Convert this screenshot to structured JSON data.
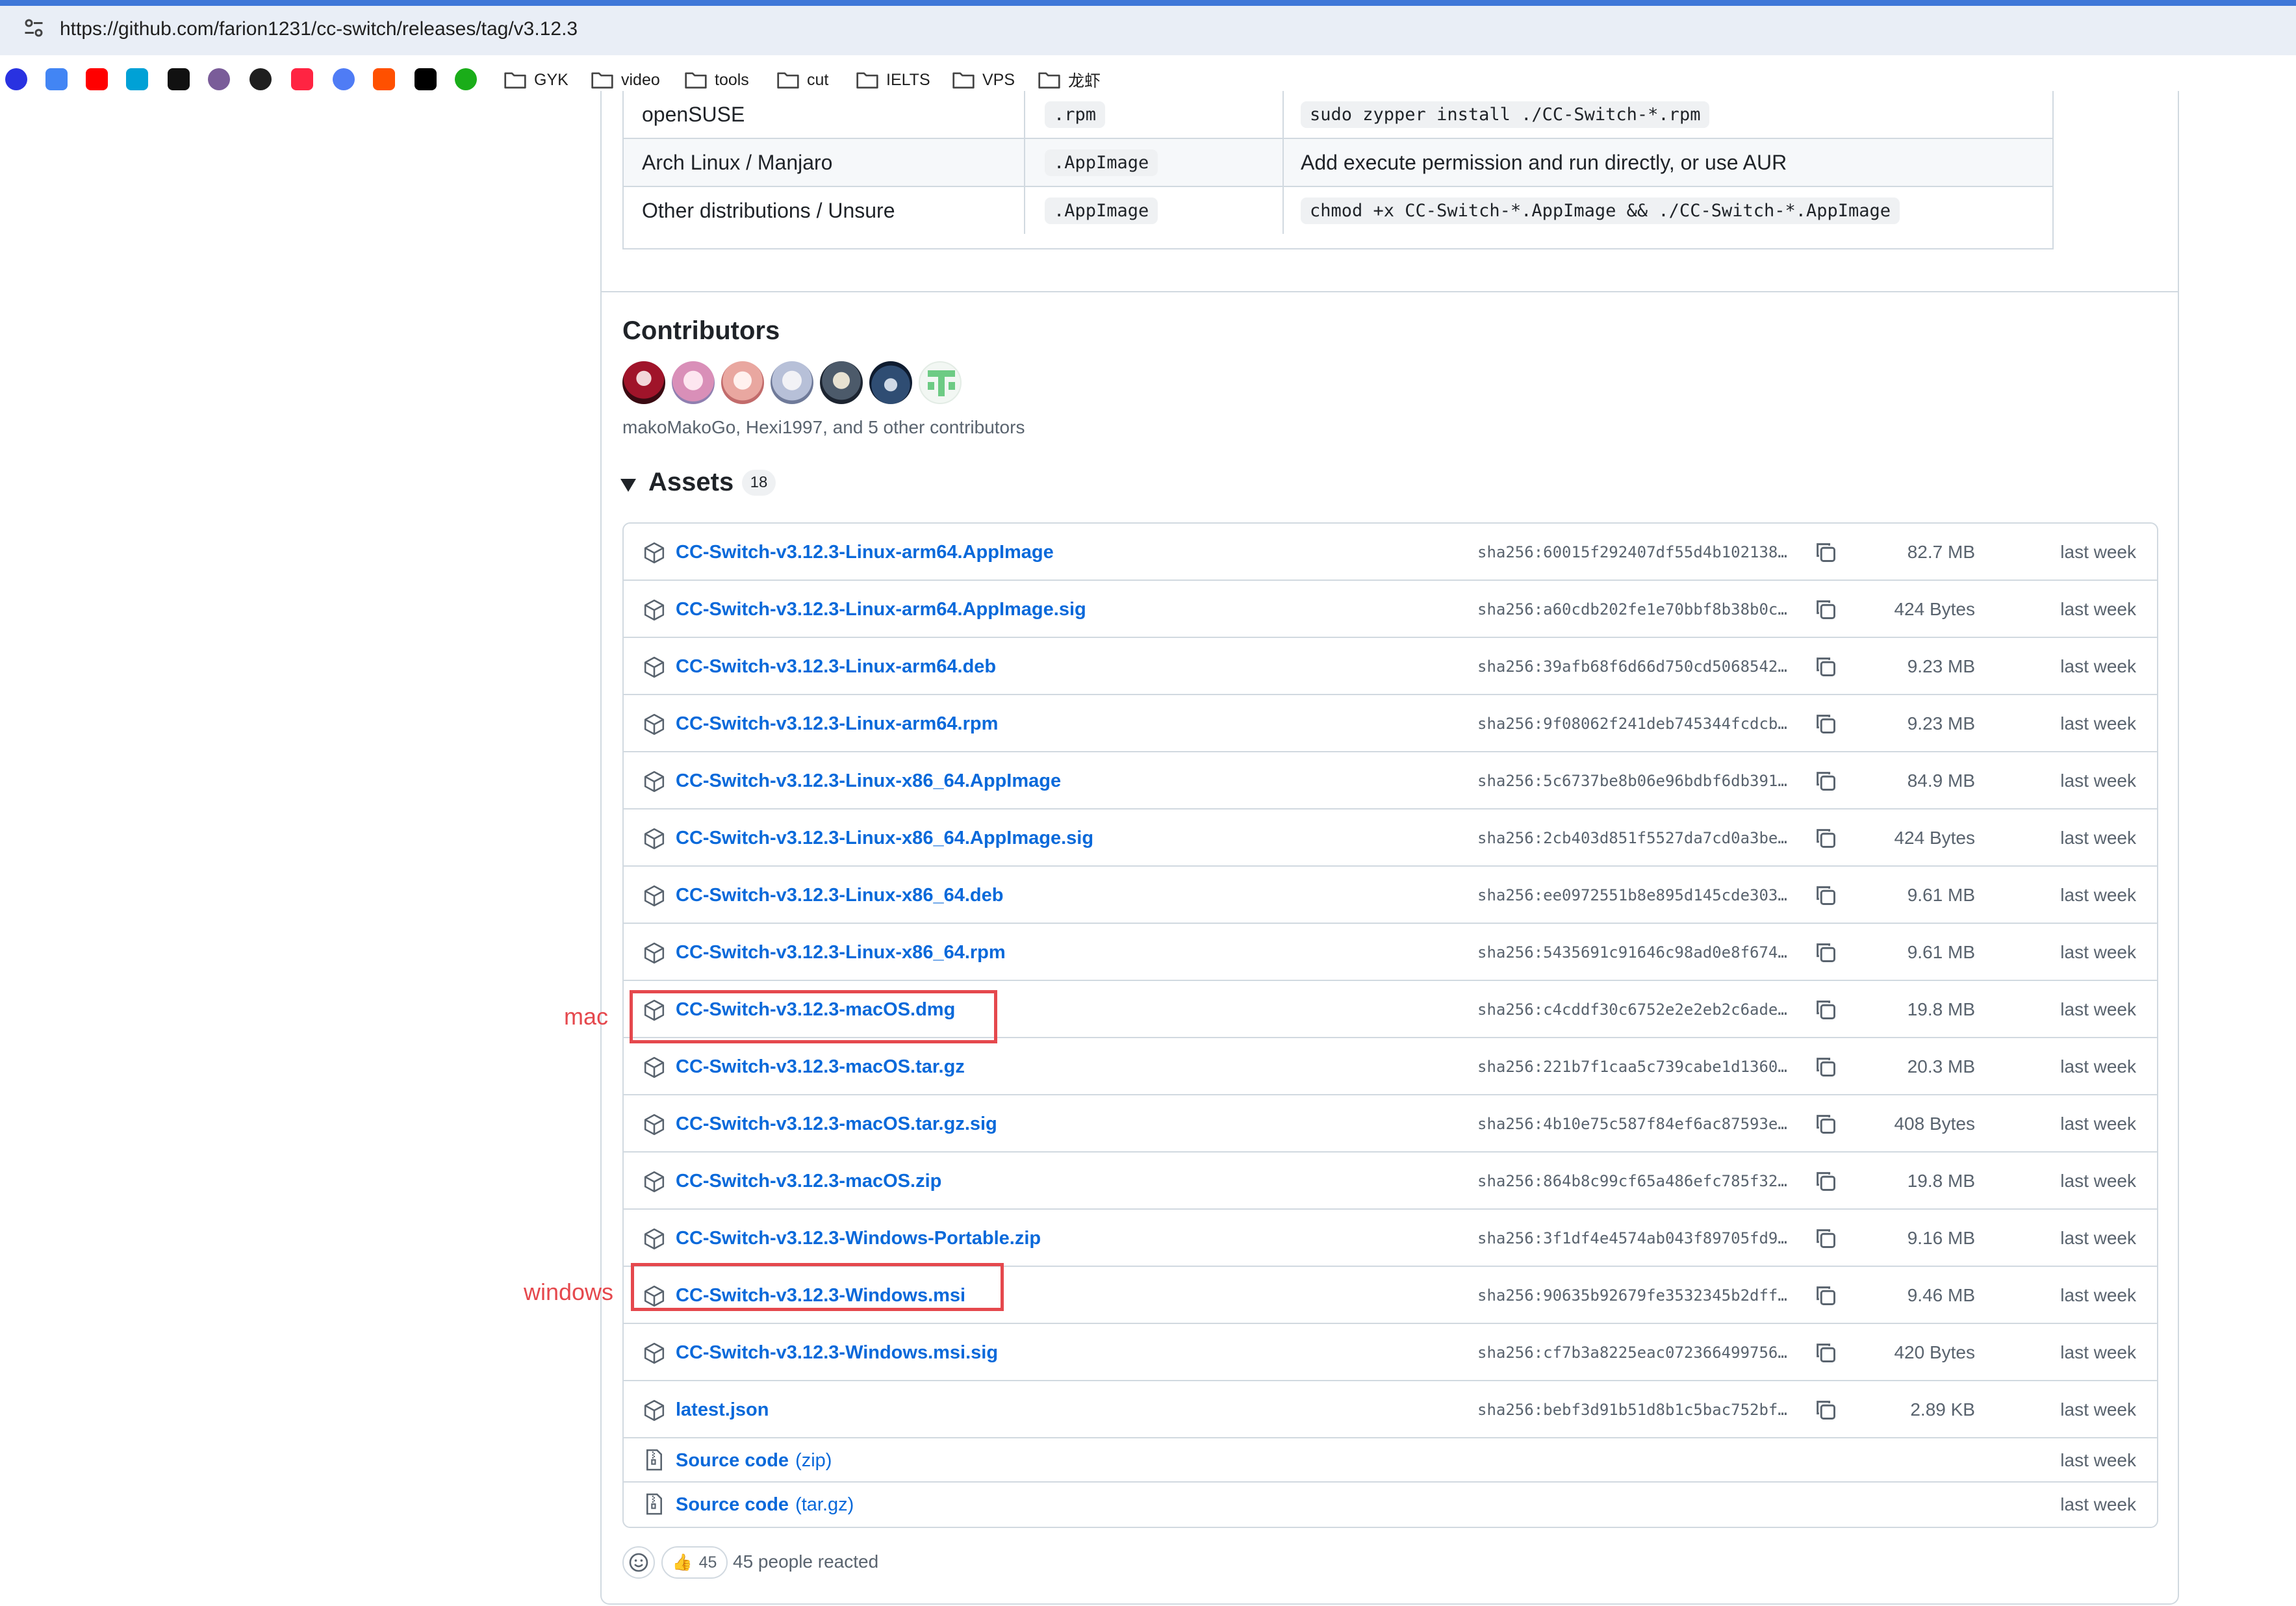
{
  "browser": {
    "url": "https://github.com/farion1231/cc-switch/releases/tag/v3.12.3",
    "bookmark_icons": [
      {
        "name": "baidu",
        "color": "#2932e1"
      },
      {
        "name": "translate",
        "color": "#4285f4"
      },
      {
        "name": "youtube",
        "color": "#ff0000"
      },
      {
        "name": "bilibili",
        "color": "#00a1d6"
      },
      {
        "name": "tiktok",
        "color": "#111111"
      },
      {
        "name": "avatar-site",
        "color": "#7a5c99"
      },
      {
        "name": "openai",
        "color": "#1f1f1f"
      },
      {
        "name": "xiaohongshu",
        "color": "#ff2442"
      },
      {
        "name": "gemini",
        "color": "#4f7cf5"
      },
      {
        "name": "taobao",
        "color": "#ff5000"
      },
      {
        "name": "x",
        "color": "#000000"
      },
      {
        "name": "recycle",
        "color": "#1aad19"
      }
    ],
    "bookmark_folders": [
      "GYK",
      "video",
      "tools",
      "cut",
      "IELTS",
      "VPS",
      "龙虾"
    ]
  },
  "install_table": {
    "rows": [
      {
        "distro": "openSUSE",
        "format": ".rpm",
        "method": "sudo zypper install ./CC-Switch-*.rpm",
        "method_is_code": true
      },
      {
        "distro": "Arch Linux / Manjaro",
        "format": ".AppImage",
        "method": "Add execute permission and run directly, or use AUR",
        "method_is_code": false
      },
      {
        "distro": "Other distributions / Unsure",
        "format": ".AppImage",
        "method": "chmod +x CC-Switch-*.AppImage && ./CC-Switch-*.AppImage",
        "method_is_code": true
      }
    ]
  },
  "contributors": {
    "heading": "Contributors",
    "summary": "makoMakoGo, Hexi1997, and 5 other contributors",
    "avatar_count": 7
  },
  "assets": {
    "heading": "Assets",
    "count": "18",
    "files": [
      {
        "name": "CC-Switch-v3.12.3-Linux-arm64.AppImage",
        "sha": "sha256:60015f292407df55d4b102138…",
        "size": "82.7 MB",
        "date": "last week"
      },
      {
        "name": "CC-Switch-v3.12.3-Linux-arm64.AppImage.sig",
        "sha": "sha256:a60cdb202fe1e70bbf8b38b0c…",
        "size": "424 Bytes",
        "date": "last week"
      },
      {
        "name": "CC-Switch-v3.12.3-Linux-arm64.deb",
        "sha": "sha256:39afb68f6d66d750cd5068542…",
        "size": "9.23 MB",
        "date": "last week"
      },
      {
        "name": "CC-Switch-v3.12.3-Linux-arm64.rpm",
        "sha": "sha256:9f08062f241deb745344fcdcb…",
        "size": "9.23 MB",
        "date": "last week"
      },
      {
        "name": "CC-Switch-v3.12.3-Linux-x86_64.AppImage",
        "sha": "sha256:5c6737be8b06e96bdbf6db391…",
        "size": "84.9 MB",
        "date": "last week"
      },
      {
        "name": "CC-Switch-v3.12.3-Linux-x86_64.AppImage.sig",
        "sha": "sha256:2cb403d851f5527da7cd0a3be…",
        "size": "424 Bytes",
        "date": "last week"
      },
      {
        "name": "CC-Switch-v3.12.3-Linux-x86_64.deb",
        "sha": "sha256:ee0972551b8e895d145cde303…",
        "size": "9.61 MB",
        "date": "last week"
      },
      {
        "name": "CC-Switch-v3.12.3-Linux-x86_64.rpm",
        "sha": "sha256:5435691c91646c98ad0e8f674…",
        "size": "9.61 MB",
        "date": "last week"
      },
      {
        "name": "CC-Switch-v3.12.3-macOS.dmg",
        "sha": "sha256:c4cddf30c6752e2e2eb2c6ade…",
        "size": "19.8 MB",
        "date": "last week"
      },
      {
        "name": "CC-Switch-v3.12.3-macOS.tar.gz",
        "sha": "sha256:221b7f1caa5c739cabe1d1360…",
        "size": "20.3 MB",
        "date": "last week"
      },
      {
        "name": "CC-Switch-v3.12.3-macOS.tar.gz.sig",
        "sha": "sha256:4b10e75c587f84ef6ac87593e…",
        "size": "408 Bytes",
        "date": "last week"
      },
      {
        "name": "CC-Switch-v3.12.3-macOS.zip",
        "sha": "sha256:864b8c99cf65a486efc785f32…",
        "size": "19.8 MB",
        "date": "last week"
      },
      {
        "name": "CC-Switch-v3.12.3-Windows-Portable.zip",
        "sha": "sha256:3f1df4e4574ab043f89705fd9…",
        "size": "9.16 MB",
        "date": "last week"
      },
      {
        "name": "CC-Switch-v3.12.3-Windows.msi",
        "sha": "sha256:90635b92679fe3532345b2dff…",
        "size": "9.46 MB",
        "date": "last week"
      },
      {
        "name": "CC-Switch-v3.12.3-Windows.msi.sig",
        "sha": "sha256:cf7b3a8225eac072366499756…",
        "size": "420 Bytes",
        "date": "last week"
      },
      {
        "name": "latest.json",
        "sha": "sha256:bebf3d91b51d8b1c5bac752bf…",
        "size": "2.89 KB",
        "date": "last week"
      }
    ],
    "source_files": [
      {
        "label": "Source code",
        "format": "(zip)",
        "date": "last week"
      },
      {
        "label": "Source code",
        "format": "(tar.gz)",
        "date": "last week"
      }
    ]
  },
  "annotations": {
    "mac_label": "mac",
    "windows_label": "windows",
    "color": "#e5484d"
  },
  "reactions": {
    "thumbs_count": "45",
    "summary": "45 people reacted"
  },
  "colors": {
    "link": "#0969da",
    "muted": "#59636e",
    "border": "#d1d9e0",
    "accent": "#3f77d8"
  }
}
